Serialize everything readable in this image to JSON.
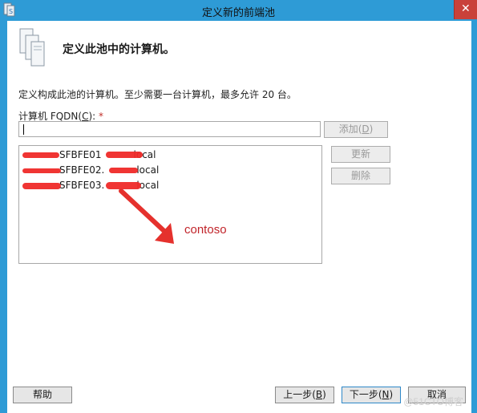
{
  "window": {
    "title": "定义新的前端池",
    "close_glyph": "✕"
  },
  "header": {
    "heading": "定义此池中的计算机。"
  },
  "description": "定义构成此池的计算机。至少需要一台计算机，最多允许 20 台。",
  "fqdn_field": {
    "label_prefix": "计算机 FQDN(",
    "label_accel": "C",
    "label_suffix": "): ",
    "required_mark": "*",
    "value": ""
  },
  "buttons": {
    "add_prefix": "添加(",
    "add_accel": "D",
    "add_suffix": ")",
    "update": "更新",
    "delete": "删除",
    "help": "帮助",
    "back_prefix": "上一步(",
    "back_accel": "B",
    "back_suffix": ")",
    "next_prefix": "下一步(",
    "next_accel": "N",
    "next_suffix": ")",
    "cancel": "取消"
  },
  "computers": [
    {
      "visible_start": "SFBFE01",
      "visible_end": "local"
    },
    {
      "visible_start": "SFBFE02.",
      "visible_end": "local"
    },
    {
      "visible_start": "SFBFE03.",
      "visible_end": "local"
    }
  ],
  "annotation": {
    "text": "contoso",
    "color": "#c1242a"
  },
  "watermark": "@51CTO博客",
  "colors": {
    "titlebar": "#2e9bd6",
    "close": "#c9413a",
    "redaction": "#ef2a28"
  }
}
